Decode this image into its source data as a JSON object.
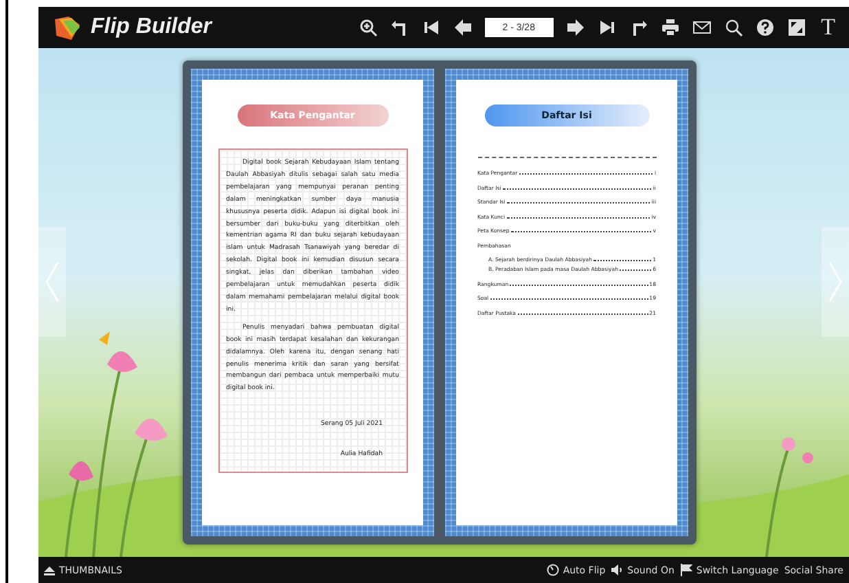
{
  "toolbar": {
    "brand": "Flip Builder",
    "page_field": "2 - 3/28",
    "text_button": "T"
  },
  "left_page": {
    "heading": "Kata Pengantar",
    "paragraphs": [
      "Digital book Sejarah Kebudayaan Islam tentang Daulah Abbasiyah ditulis sebagai salah satu media pembelajaran yang mempunyai peranan penting dalam meningkatkan sumber daya manusia khususnya peserta didik. Adapun isi digital book ini bersumber dari buku-buku yang diterbitkan oleh kementrian agama RI dan buku sejarah kebudayaan islam untuk Madrasah Tsanawiyah yang beredar di sekolah. Digital book ini kemudian disusun secara singkat, jelas dan diberikan tambahan video pembelajaran untuk memudahkan peserta didik dalam memahami pembelajaran melalui digital book ini.",
      "Penulis menyadari bahwa pembuatan digital book ini masih terdapat kesalahan dan kekurangan didalamnya. Oleh karena itu, dengan senang hati penulis menerima kritik dan saran yang bersifat membangun dari pembaca untuk memperbaiki mutu digital book ini."
    ],
    "place_date": "Serang 05 Juli 2021",
    "author": "Aulia Hafidah"
  },
  "right_page": {
    "heading": "Daftar Isi",
    "toc": [
      {
        "label": "Kata Pengantar",
        "page": "i"
      },
      {
        "label": "Daftar Isi",
        "page": "ii"
      },
      {
        "label": "Standar Isi",
        "page": "iii"
      },
      {
        "label": "Kata Kunci",
        "page": "iv"
      },
      {
        "label": "Peta Konsep",
        "page": "v"
      },
      {
        "label": "Pembahasan",
        "children": [
          {
            "label": "A. Sejarah berdirinya Daulah Abbasiyah",
            "page": "1"
          },
          {
            "label": "B. Peradaban Islam pada masa Daulah Abbasiyah",
            "page": "6"
          }
        ]
      },
      {
        "label": "Rangkuman",
        "page": "18"
      },
      {
        "label": "Soal",
        "page": "19"
      },
      {
        "label": "Daftar Pustaka",
        "page": "21"
      }
    ]
  },
  "bottom_bar": {
    "thumbnails": "THUMBNAILS",
    "auto_flip": "Auto Flip",
    "sound": "Sound On",
    "language": "Switch Language",
    "share": "Social Share"
  }
}
